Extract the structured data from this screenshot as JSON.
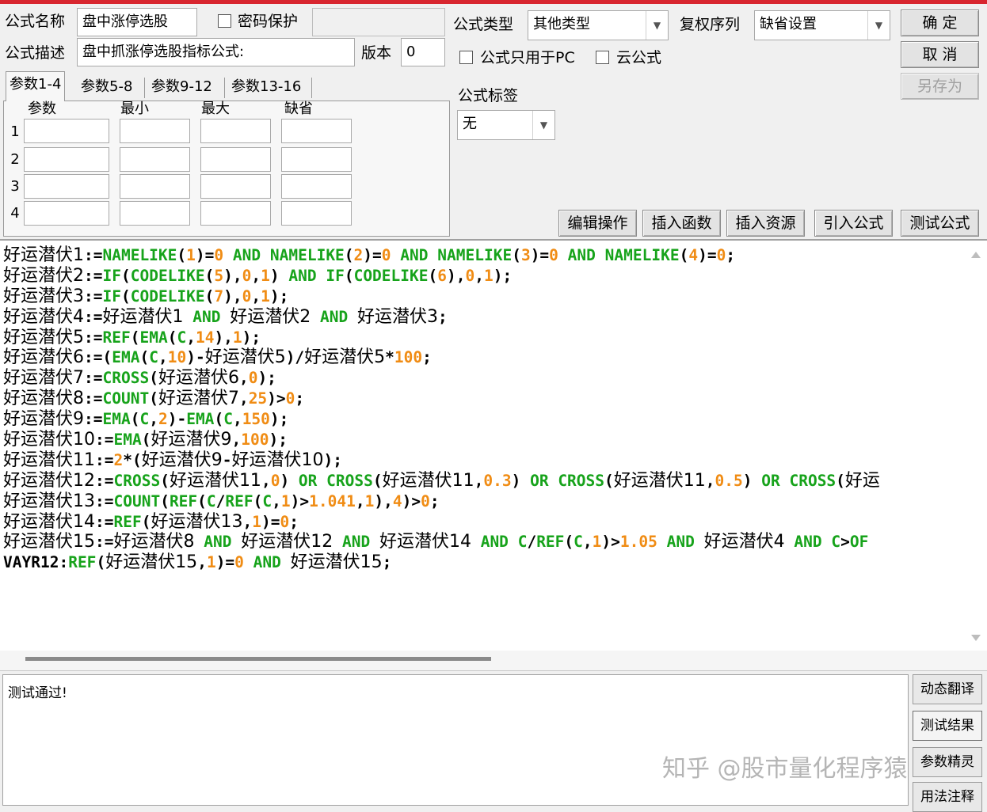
{
  "form": {
    "name_label": "公式名称",
    "name_value": "盘中涨停选股",
    "password_label": "密码保护",
    "password_value": "",
    "desc_label": "公式描述",
    "desc_value": "盘中抓涨停选股指标公式:",
    "version_label": "版本",
    "version_value": "0",
    "type_label": "公式类型",
    "type_value": "其他类型",
    "fuquan_label": "复权序列",
    "fuquan_value": "缺省设置",
    "pc_only_label": "公式只用于PC",
    "cloud_label": "云公式",
    "tag_label": "公式标签",
    "tag_value": "无"
  },
  "buttons": {
    "ok": "确 定",
    "cancel": "取 消",
    "save_as": "另存为",
    "edit_ops": "编辑操作",
    "insert_func": "插入函数",
    "insert_res": "插入资源",
    "import_formula": "引入公式",
    "test_formula": "测试公式"
  },
  "params": {
    "tabs": [
      "参数1-4",
      "参数5-8",
      "参数9-12",
      "参数13-16"
    ],
    "columns": [
      "参数",
      "最小",
      "最大",
      "缺省"
    ],
    "rows": [
      "1",
      "2",
      "3",
      "4"
    ]
  },
  "code_lines": [
    [
      [
        "v",
        "好运潜伏1"
      ],
      [
        "o",
        ":="
      ],
      [
        "k",
        "NAMELIKE"
      ],
      [
        "o",
        "("
      ],
      [
        "n",
        "1"
      ],
      [
        "o",
        ")="
      ],
      [
        "n",
        "0"
      ],
      [
        "o",
        " "
      ],
      [
        "k",
        "AND"
      ],
      [
        "o",
        " "
      ],
      [
        "k",
        "NAMELIKE"
      ],
      [
        "o",
        "("
      ],
      [
        "n",
        "2"
      ],
      [
        "o",
        ")="
      ],
      [
        "n",
        "0"
      ],
      [
        "o",
        " "
      ],
      [
        "k",
        "AND"
      ],
      [
        "o",
        " "
      ],
      [
        "k",
        "NAMELIKE"
      ],
      [
        "o",
        "("
      ],
      [
        "n",
        "3"
      ],
      [
        "o",
        ")="
      ],
      [
        "n",
        "0"
      ],
      [
        "o",
        " "
      ],
      [
        "k",
        "AND"
      ],
      [
        "o",
        " "
      ],
      [
        "k",
        "NAMELIKE"
      ],
      [
        "o",
        "("
      ],
      [
        "n",
        "4"
      ],
      [
        "o",
        ")="
      ],
      [
        "n",
        "0"
      ],
      [
        "o",
        ";"
      ]
    ],
    [
      [
        "v",
        "好运潜伏2"
      ],
      [
        "o",
        ":="
      ],
      [
        "k",
        "IF"
      ],
      [
        "o",
        "("
      ],
      [
        "k",
        "CODELIKE"
      ],
      [
        "o",
        "("
      ],
      [
        "n",
        "5"
      ],
      [
        "o",
        "),"
      ],
      [
        "n",
        "0"
      ],
      [
        "o",
        ","
      ],
      [
        "n",
        "1"
      ],
      [
        "o",
        ") "
      ],
      [
        "k",
        "AND"
      ],
      [
        "o",
        " "
      ],
      [
        "k",
        "IF"
      ],
      [
        "o",
        "("
      ],
      [
        "k",
        "CODELIKE"
      ],
      [
        "o",
        "("
      ],
      [
        "n",
        "6"
      ],
      [
        "o",
        "),"
      ],
      [
        "n",
        "0"
      ],
      [
        "o",
        ","
      ],
      [
        "n",
        "1"
      ],
      [
        "o",
        ");"
      ]
    ],
    [
      [
        "v",
        "好运潜伏3"
      ],
      [
        "o",
        ":="
      ],
      [
        "k",
        "IF"
      ],
      [
        "o",
        "("
      ],
      [
        "k",
        "CODELIKE"
      ],
      [
        "o",
        "("
      ],
      [
        "n",
        "7"
      ],
      [
        "o",
        "),"
      ],
      [
        "n",
        "0"
      ],
      [
        "o",
        ","
      ],
      [
        "n",
        "1"
      ],
      [
        "o",
        ");"
      ]
    ],
    [
      [
        "v",
        "好运潜伏4"
      ],
      [
        "o",
        ":="
      ],
      [
        "v",
        "好运潜伏1"
      ],
      [
        "o",
        " "
      ],
      [
        "k",
        "AND"
      ],
      [
        "o",
        " "
      ],
      [
        "v",
        "好运潜伏2"
      ],
      [
        "o",
        " "
      ],
      [
        "k",
        "AND"
      ],
      [
        "o",
        " "
      ],
      [
        "v",
        "好运潜伏3"
      ],
      [
        "o",
        ";"
      ]
    ],
    [
      [
        "v",
        "好运潜伏5"
      ],
      [
        "o",
        ":="
      ],
      [
        "k",
        "REF"
      ],
      [
        "o",
        "("
      ],
      [
        "k",
        "EMA"
      ],
      [
        "o",
        "("
      ],
      [
        "k",
        "C"
      ],
      [
        "o",
        ","
      ],
      [
        "n",
        "14"
      ],
      [
        "o",
        "),"
      ],
      [
        "n",
        "1"
      ],
      [
        "o",
        ");"
      ]
    ],
    [
      [
        "v",
        "好运潜伏6"
      ],
      [
        "o",
        ":=("
      ],
      [
        "k",
        "EMA"
      ],
      [
        "o",
        "("
      ],
      [
        "k",
        "C"
      ],
      [
        "o",
        ","
      ],
      [
        "n",
        "10"
      ],
      [
        "o",
        ")-"
      ],
      [
        "v",
        "好运潜伏5"
      ],
      [
        "o",
        ")/"
      ],
      [
        "v",
        "好运潜伏5"
      ],
      [
        "o",
        "*"
      ],
      [
        "n",
        "100"
      ],
      [
        "o",
        ";"
      ]
    ],
    [
      [
        "v",
        "好运潜伏7"
      ],
      [
        "o",
        ":="
      ],
      [
        "k",
        "CROSS"
      ],
      [
        "o",
        "("
      ],
      [
        "v",
        "好运潜伏6"
      ],
      [
        "o",
        ","
      ],
      [
        "n",
        "0"
      ],
      [
        "o",
        ");"
      ]
    ],
    [
      [
        "v",
        "好运潜伏8"
      ],
      [
        "o",
        ":="
      ],
      [
        "k",
        "COUNT"
      ],
      [
        "o",
        "("
      ],
      [
        "v",
        "好运潜伏7"
      ],
      [
        "o",
        ","
      ],
      [
        "n",
        "25"
      ],
      [
        "o",
        ")>"
      ],
      [
        "n",
        "0"
      ],
      [
        "o",
        ";"
      ]
    ],
    [
      [
        "v",
        "好运潜伏9"
      ],
      [
        "o",
        ":="
      ],
      [
        "k",
        "EMA"
      ],
      [
        "o",
        "("
      ],
      [
        "k",
        "C"
      ],
      [
        "o",
        ","
      ],
      [
        "n",
        "2"
      ],
      [
        "o",
        ")-"
      ],
      [
        "k",
        "EMA"
      ],
      [
        "o",
        "("
      ],
      [
        "k",
        "C"
      ],
      [
        "o",
        ","
      ],
      [
        "n",
        "150"
      ],
      [
        "o",
        ");"
      ]
    ],
    [
      [
        "v",
        "好运潜伏10"
      ],
      [
        "o",
        ":="
      ],
      [
        "k",
        "EMA"
      ],
      [
        "o",
        "("
      ],
      [
        "v",
        "好运潜伏9"
      ],
      [
        "o",
        ","
      ],
      [
        "n",
        "100"
      ],
      [
        "o",
        ");"
      ]
    ],
    [
      [
        "v",
        "好运潜伏11"
      ],
      [
        "o",
        ":="
      ],
      [
        "n",
        "2"
      ],
      [
        "o",
        "*("
      ],
      [
        "v",
        "好运潜伏9"
      ],
      [
        "o",
        "-"
      ],
      [
        "v",
        "好运潜伏10"
      ],
      [
        "o",
        ");"
      ]
    ],
    [
      [
        "v",
        "好运潜伏12"
      ],
      [
        "o",
        ":="
      ],
      [
        "k",
        "CROSS"
      ],
      [
        "o",
        "("
      ],
      [
        "v",
        "好运潜伏11"
      ],
      [
        "o",
        ","
      ],
      [
        "n",
        "0"
      ],
      [
        "o",
        ") "
      ],
      [
        "k",
        "OR"
      ],
      [
        "o",
        " "
      ],
      [
        "k",
        "CROSS"
      ],
      [
        "o",
        "("
      ],
      [
        "v",
        "好运潜伏11"
      ],
      [
        "o",
        ","
      ],
      [
        "n",
        "0.3"
      ],
      [
        "o",
        ") "
      ],
      [
        "k",
        "OR"
      ],
      [
        "o",
        " "
      ],
      [
        "k",
        "CROSS"
      ],
      [
        "o",
        "("
      ],
      [
        "v",
        "好运潜伏11"
      ],
      [
        "o",
        ","
      ],
      [
        "n",
        "0.5"
      ],
      [
        "o",
        ") "
      ],
      [
        "k",
        "OR"
      ],
      [
        "o",
        " "
      ],
      [
        "k",
        "CROSS"
      ],
      [
        "o",
        "("
      ],
      [
        "v",
        "好运"
      ]
    ],
    [
      [
        "v",
        "好运潜伏13"
      ],
      [
        "o",
        ":="
      ],
      [
        "k",
        "COUNT"
      ],
      [
        "o",
        "("
      ],
      [
        "k",
        "REF"
      ],
      [
        "o",
        "("
      ],
      [
        "k",
        "C"
      ],
      [
        "o",
        "/"
      ],
      [
        "k",
        "REF"
      ],
      [
        "o",
        "("
      ],
      [
        "k",
        "C"
      ],
      [
        "o",
        ","
      ],
      [
        "n",
        "1"
      ],
      [
        "o",
        ")>"
      ],
      [
        "n",
        "1.041"
      ],
      [
        "o",
        ","
      ],
      [
        "n",
        "1"
      ],
      [
        "o",
        "),"
      ],
      [
        "n",
        "4"
      ],
      [
        "o",
        ")>"
      ],
      [
        "n",
        "0"
      ],
      [
        "o",
        ";"
      ]
    ],
    [
      [
        "v",
        "好运潜伏14"
      ],
      [
        "o",
        ":="
      ],
      [
        "k",
        "REF"
      ],
      [
        "o",
        "("
      ],
      [
        "v",
        "好运潜伏13"
      ],
      [
        "o",
        ","
      ],
      [
        "n",
        "1"
      ],
      [
        "o",
        ")="
      ],
      [
        "n",
        "0"
      ],
      [
        "o",
        ";"
      ]
    ],
    [
      [
        "v",
        "好运潜伏15"
      ],
      [
        "o",
        ":="
      ],
      [
        "v",
        "好运潜伏8"
      ],
      [
        "o",
        " "
      ],
      [
        "k",
        "AND"
      ],
      [
        "o",
        " "
      ],
      [
        "v",
        "好运潜伏12"
      ],
      [
        "o",
        " "
      ],
      [
        "k",
        "AND"
      ],
      [
        "o",
        " "
      ],
      [
        "v",
        "好运潜伏14"
      ],
      [
        "o",
        " "
      ],
      [
        "k",
        "AND"
      ],
      [
        "o",
        " "
      ],
      [
        "k",
        "C"
      ],
      [
        "o",
        "/"
      ],
      [
        "k",
        "REF"
      ],
      [
        "o",
        "("
      ],
      [
        "k",
        "C"
      ],
      [
        "o",
        ","
      ],
      [
        "n",
        "1"
      ],
      [
        "o",
        ")>"
      ],
      [
        "n",
        "1.05"
      ],
      [
        "o",
        " "
      ],
      [
        "k",
        "AND"
      ],
      [
        "o",
        " "
      ],
      [
        "v",
        "好运潜伏4"
      ],
      [
        "o",
        " "
      ],
      [
        "k",
        "AND"
      ],
      [
        "o",
        " "
      ],
      [
        "k",
        "C"
      ],
      [
        "o",
        ">"
      ],
      [
        "k",
        "OF"
      ]
    ],
    [
      [
        "d",
        "VAYR12"
      ],
      [
        "o",
        ":"
      ],
      [
        "k",
        "REF"
      ],
      [
        "o",
        "("
      ],
      [
        "v",
        "好运潜伏15"
      ],
      [
        "o",
        ","
      ],
      [
        "n",
        "1"
      ],
      [
        "o",
        ")="
      ],
      [
        "n",
        "0"
      ],
      [
        "o",
        " "
      ],
      [
        "k",
        "AND"
      ],
      [
        "o",
        " "
      ],
      [
        "v",
        "好运潜伏15"
      ],
      [
        "o",
        ";"
      ]
    ]
  ],
  "output": {
    "message": "测试通过!"
  },
  "side_buttons": [
    "动态翻译",
    "测试结果",
    "参数精灵",
    "用法注释"
  ],
  "watermark": "知乎 @股市量化程序猿",
  "colors": {
    "keyword": "#17a31b",
    "number": "#f08c14",
    "title_bar": "#d8262f"
  }
}
